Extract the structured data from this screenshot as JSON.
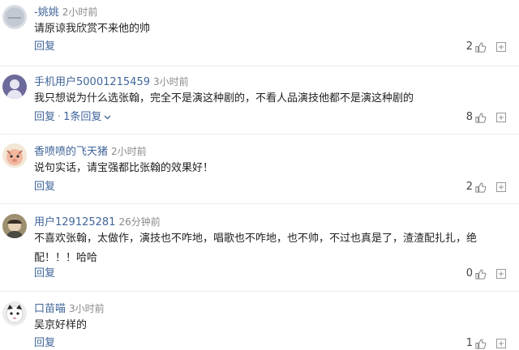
{
  "reply_label": "回复",
  "comments": [
    {
      "user": "-姚姚",
      "time": "2小时前",
      "text": "请原谅我欣赏不来他的帅",
      "likes": "2",
      "replies_label": ""
    },
    {
      "user": "手机用户50001215459",
      "time": "3小时前",
      "text": "我只想说为什么选张翰，完全不是演这种剧的，不看人品演技他都不是演这种剧的",
      "likes": "8",
      "replies_label": "1条回复"
    },
    {
      "user": "香喷喷的飞天猪",
      "time": "2小时前",
      "text": "说句实话，请宝强都比张翰的效果好！",
      "likes": "2",
      "replies_label": ""
    },
    {
      "user": "用户129125281",
      "time": "26分钟前",
      "text": "不喜欢张翰，太做作，演技也不咋地，唱歌也不咋地，也不帅，不过也真是了，渣渣配扎扎，绝配！！！哈哈",
      "likes": "0",
      "replies_label": ""
    },
    {
      "user": "口苗喵",
      "time": "3小时前",
      "text": "吴京好样的",
      "likes": "1",
      "replies_label": ""
    }
  ]
}
